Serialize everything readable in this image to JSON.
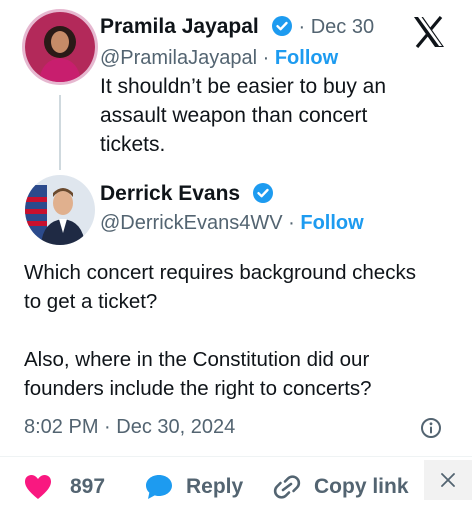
{
  "quoted_post": {
    "author_name": "Pramila Jayapal",
    "handle": "@PramilaJayapal",
    "date": "Dec 30",
    "follow_label": "Follow",
    "text_lines": [
      "It shouldn’t be easier to buy an",
      "assault weapon than concert",
      "tickets."
    ]
  },
  "reply_post": {
    "author_name": "Derrick Evans",
    "handle": "@DerrickEvans4WV",
    "follow_label": "Follow",
    "text_lines": [
      "Which concert requires background checks",
      "to get a ticket?",
      "",
      "Also, where in the Constitution did our",
      "founders include the right to concerts?"
    ],
    "timestamp": "8:02 PM · Dec 30, 2024"
  },
  "actions": {
    "likes": "897",
    "reply_label": "Reply",
    "copy_link_label": "Copy link"
  },
  "separator": "·",
  "colors": {
    "accent": "#1d9bf0",
    "like": "#f91880",
    "secondary_text": "#536471"
  },
  "icons": [
    "x-logo-icon",
    "verified-badge-icon",
    "info-icon",
    "heart-icon",
    "reply-icon",
    "link-icon",
    "close-icon"
  ]
}
